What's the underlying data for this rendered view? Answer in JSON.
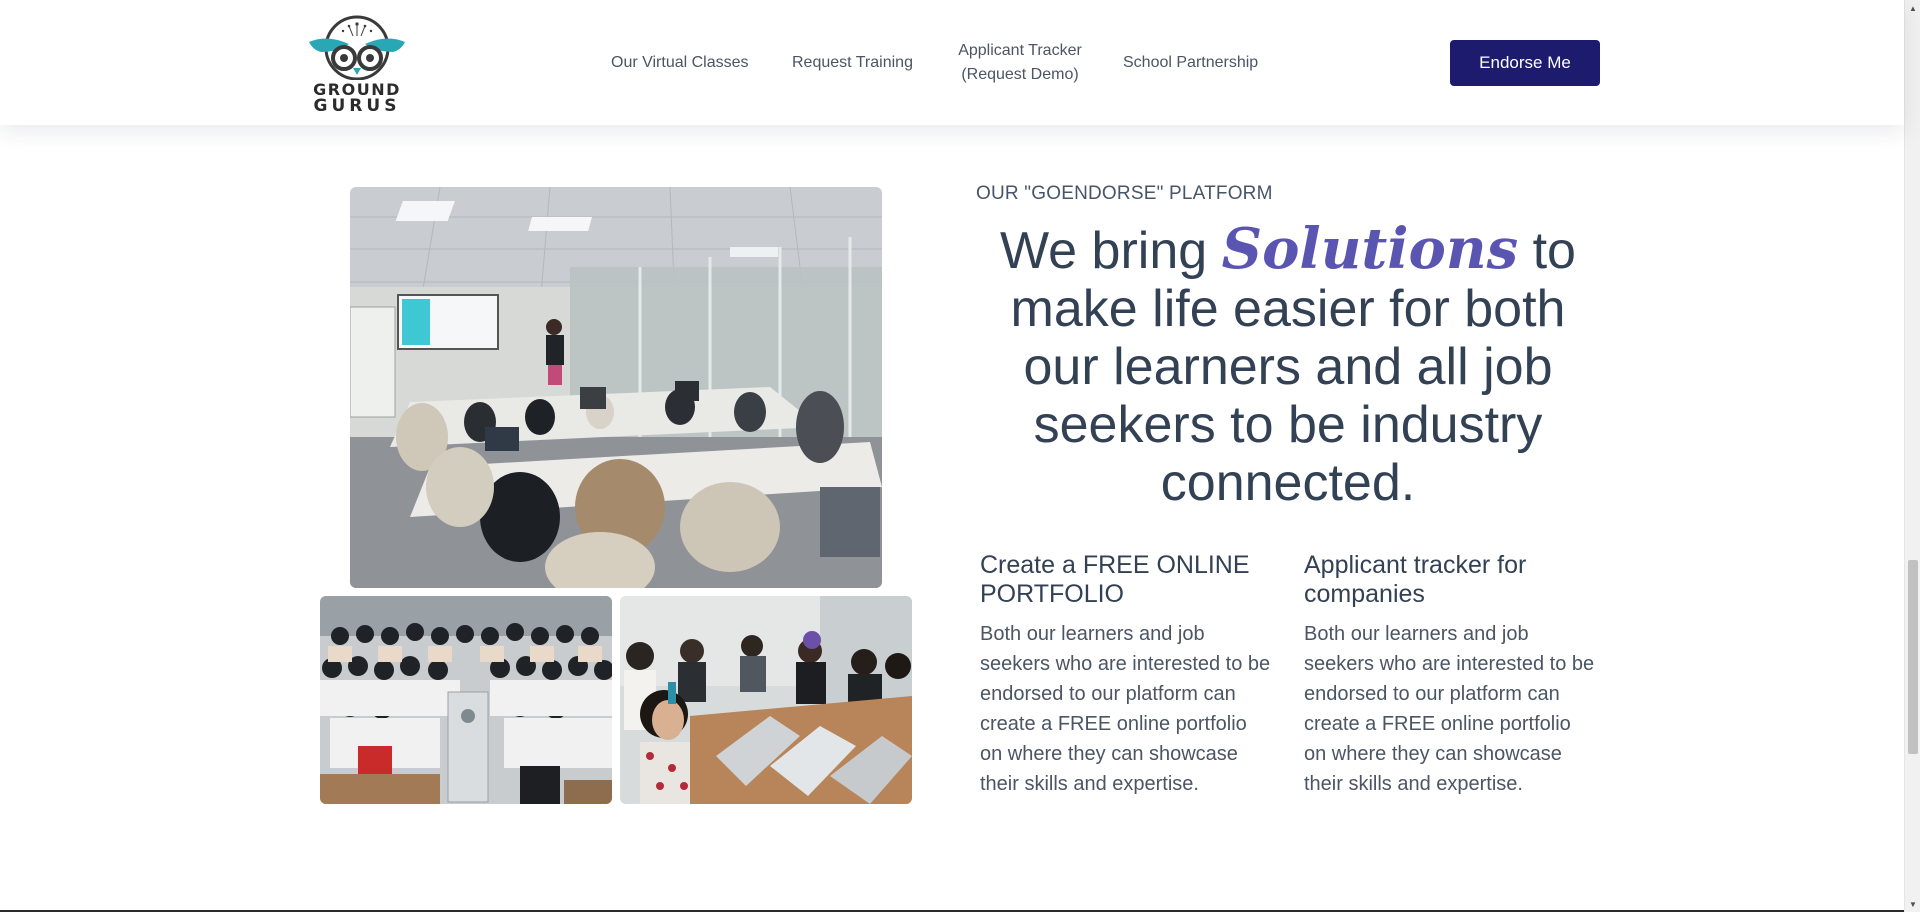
{
  "brand": {
    "name_line1": "GROUND",
    "name_line2": "GURUS"
  },
  "nav": {
    "items": [
      {
        "label": "Our Virtual Classes"
      },
      {
        "label": "Request Training"
      },
      {
        "label": "Applicant Tracker (Request Demo)"
      },
      {
        "label": "School Partnership"
      }
    ],
    "cta_label": "Endorse Me"
  },
  "section": {
    "eyebrow": "OUR \"GOENDORSE\" PLATFORM",
    "headline_before": "We bring ",
    "headline_accent": "Solutions",
    "headline_after": " to make life easier for both our learners and all job seekers to be industry connected."
  },
  "features": [
    {
      "title": "Create a FREE ONLINE PORTFOLIO",
      "body": "Both our learners and job seekers who are interested to be endorsed to our platform can create a FREE online portfolio on where they can showcase their skills and expertise."
    },
    {
      "title": "Applicant tracker for companies",
      "body": "Both our learners and job seekers who are interested to be endorsed to our platform can create a FREE online portfolio on where they can showcase their skills and expertise."
    }
  ],
  "colors": {
    "cta_bg": "#1d1b6e",
    "accent": "#5b55b2",
    "logo_teal": "#2aa7b5",
    "text": "#334155"
  }
}
